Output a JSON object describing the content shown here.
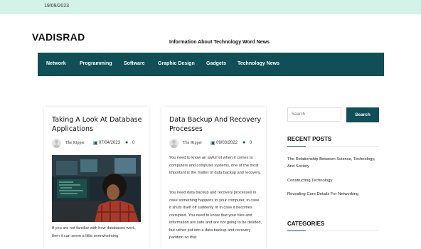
{
  "topbar": {
    "date": "19/09/2023"
  },
  "site": {
    "title": "VADISRAD",
    "tagline": "Information About Technology Word News"
  },
  "nav": {
    "items": [
      "Network",
      "Programming",
      "Software",
      "Graphic Design",
      "Gadgets",
      "Technology News"
    ]
  },
  "posts": [
    {
      "title": "Taking A Look At Database Applications",
      "author": "The Ripper",
      "date": "07/04/2023",
      "comments": "0",
      "excerpt": "If you are not familiar with how databases work, then it can seem a little overwhelming"
    },
    {
      "title": "Data Backup And Recovery Processes",
      "author": "The Ripper",
      "date": "09/03/2022",
      "comments": "0",
      "excerpt1": "You need to know an awful lot when it comes to computers and computer systems, one of the most important is the matter of data backup and recovery.",
      "excerpt2": "You need data backup and recovery processes in case something happens to your computer, in case it shuts itself off suddenly or in case it becomes corrupted. You need to know that your files and information are safe and are not going to be deleted, but rather put into a data backup and recovery partition so that"
    }
  ],
  "sidebar": {
    "search_placeholder": "Search",
    "search_button": "Search",
    "recent_title": "RECENT POSTS",
    "recent_posts": [
      "The Relationship Between Science, Technology, And Society",
      "Constructing Technology",
      "Revealing Core Details For Networking"
    ],
    "categories_title": "CATEGORIES"
  },
  "colors": {
    "accent": "#0f4f55",
    "topbar": "#d4f3e8"
  },
  "icons": {
    "date": "calendar-icon",
    "comments": "comment-icon",
    "author": "avatar"
  }
}
